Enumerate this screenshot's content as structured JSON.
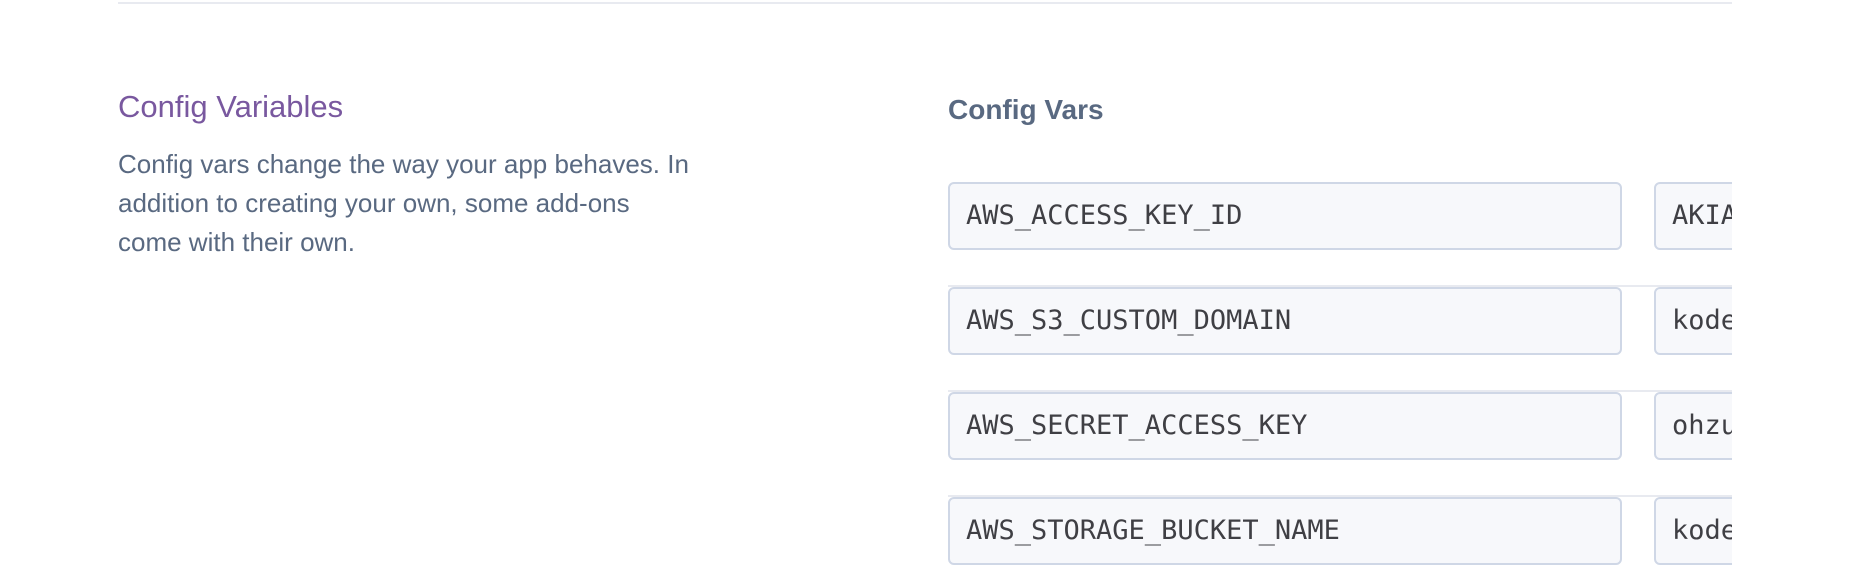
{
  "section": {
    "title": "Config Variables",
    "description": "Config vars change the way your app behaves. In addition to creating your own, some add-ons come with their own."
  },
  "config_vars": {
    "heading": "Config Vars",
    "rows": [
      {
        "key": "AWS_ACCESS_KEY_ID",
        "value_visible": "AKIA"
      },
      {
        "key": "AWS_S3_CUSTOM_DOMAIN",
        "value_visible": "kode"
      },
      {
        "key": "AWS_SECRET_ACCESS_KEY",
        "value_visible": "ohzu"
      },
      {
        "key": "AWS_STORAGE_BUCKET_NAME",
        "value_visible": "kode"
      }
    ]
  }
}
